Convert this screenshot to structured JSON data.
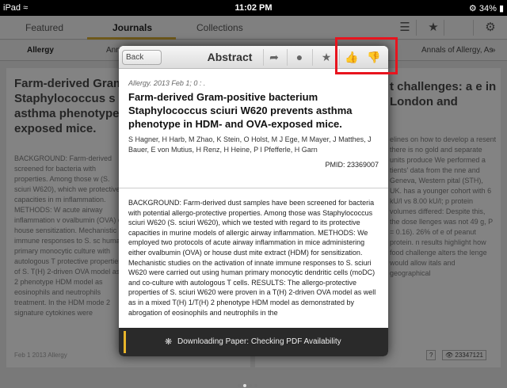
{
  "status_bar": {
    "device": "iPad",
    "wifi_icon": "wifi-icon",
    "time": "11:02 PM",
    "battery": "34%"
  },
  "nav": {
    "tabs": [
      "Featured",
      "Journals",
      "Collections"
    ],
    "active_tab": "Journals",
    "icons": [
      "list-icon",
      "star-icon",
      "gear-icon"
    ]
  },
  "subnav": {
    "left": "Allergy",
    "partial": "Ann",
    "right": "Annals of Allergy, As"
  },
  "background_cards": {
    "left": {
      "title": "Farm-derived Gram Staphylococcus s asthma phenotype exposed mice.",
      "body": "BACKGROUND: Farm-derived screened for bacteria with properties. Among those w (S. sciuri W620), which we protective capacities in m inflammation. METHODS: W acute airway inflammation v ovalbumin (OVA) or house sensitization. Mechanistic s immune responses to S. sc human primary monocytic culture with autologous T protective properties of S. T(H) 2-driven OVA model as 2 phenotype HDM model as eosinophils and neutrophils treatment. In the HDM mode 2 signature cytokines were",
      "foot": "Feb 1 2013 Allergy"
    },
    "right": {
      "title": "t challenges: a e in London and",
      "body": "elines on how to develop a resent there is no gold and separate units produce We performed a tients' data from the nne and Geneva, Western pital (STH), UK. has a younger cohort with 6 kU/l vs 8.00 kU/l; p protein volumes differed: Despite this, the dose llenges was not 49 g, P = 0.16). 26% of e of peanut protein. n results highlight how food challenge alters the lenge would allow itals and geographical",
      "badge": "23347121"
    }
  },
  "modal": {
    "back_label": "Back",
    "title": "Abstract",
    "toolbar_icons": [
      "share-icon",
      "comment-icon",
      "star-icon",
      "thumbs-up-icon",
      "thumbs-down-icon"
    ],
    "citation": "Allergy. 2013 Feb 1; 0 : .",
    "article_title": "Farm-derived Gram-positive bacterium Staphylococcus sciuri W620 prevents asthma phenotype in HDM- and OVA-exposed mice.",
    "authors": "S Hagner, H Harb, M Zhao, K Stein, O Holst, M J Ege, M Mayer, J Matthes, J Bauer, E von Mutius, H Renz, H Heine, P I Pfefferle, H Garn",
    "pmid": "PMID: 23369007",
    "abstract": "BACKGROUND: Farm-derived dust samples have been screened for bacteria with potential allergo-protective properties. Among those was Staphylococcus sciuri W620 (S. sciuri W620), which we tested with regard to its protective capacities in murine models of allergic airway inflammation. METHODS: We employed two protocols of acute airway inflammation in mice administering either ovalbumin (OVA) or house dust mite extract (HDM) for sensitization. Mechanistic studies on the activation of innate immune responses to S. sciuri W620 were carried out using human primary monocytic dendritic cells (moDC) and co-culture with autologous T cells. RESULTS: The allergo-protective properties of S. sciuri W620 were proven in a T(H) 2-driven OVA model as well as in a mixed T(H) 1/T(H) 2 phenotype HDM model as demonstrated by abrogation of eosinophils and neutrophils in the",
    "status_message": "Downloading Paper: Checking PDF Availability"
  },
  "colors": {
    "accent": "#c9a233",
    "like": "#3aa61e",
    "highlight": "#e8141e"
  }
}
